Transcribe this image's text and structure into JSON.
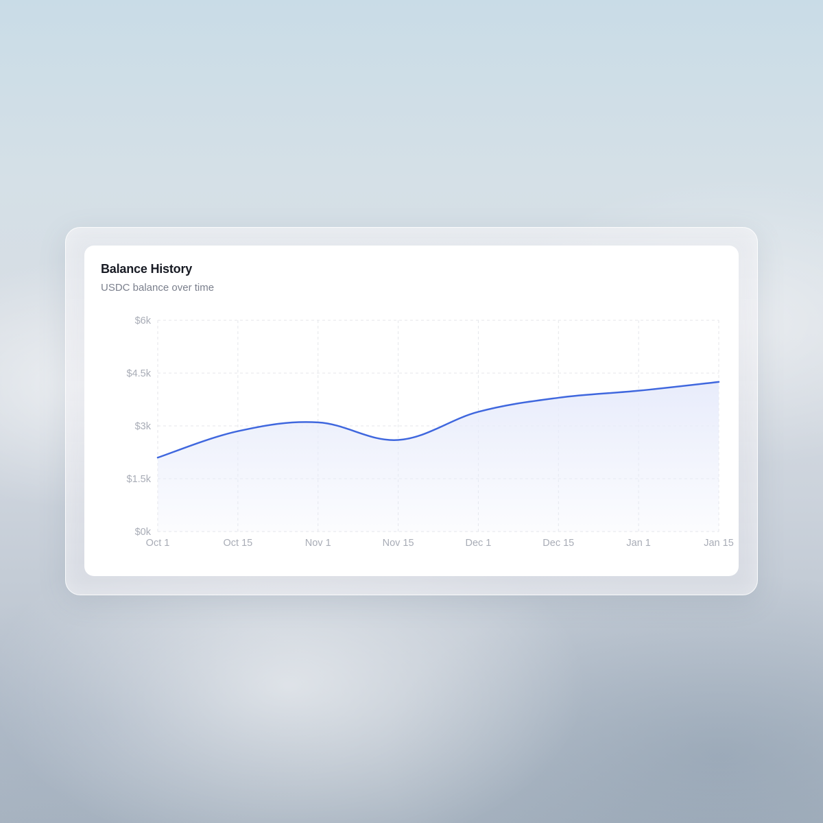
{
  "card": {
    "title": "Balance History",
    "subtitle": "USDC balance over time"
  },
  "colors": {
    "line": "#3f67de",
    "area_top": "#e8ecfb",
    "grid": "#e4e6ea",
    "tick_text": "#a8acb6"
  },
  "chart_data": {
    "type": "area",
    "title": "Balance History",
    "subtitle": "USDC balance over time",
    "xlabel": "",
    "ylabel": "",
    "x_ticks": [
      "Oct 1",
      "Oct 15",
      "Nov 1",
      "Nov 15",
      "Dec 1",
      "Dec 15",
      "Jan 1",
      "Jan 15"
    ],
    "y_ticks": [
      "$0k",
      "$1.5k",
      "$3k",
      "$4.5k",
      "$6k"
    ],
    "y_tick_values": [
      0,
      1500,
      3000,
      4500,
      6000
    ],
    "ylim": [
      0,
      6000
    ],
    "grid": true,
    "legend": "none",
    "series": [
      {
        "values": [
          2100,
          2850,
          3100,
          2600,
          3400,
          3800,
          4000,
          4250
        ]
      }
    ]
  }
}
